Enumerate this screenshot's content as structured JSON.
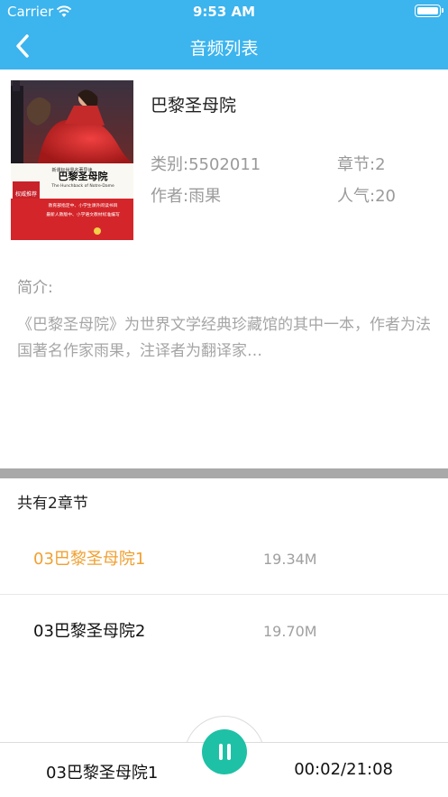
{
  "status_bar": {
    "carrier": "Carrier",
    "time": "9:53 AM"
  },
  "nav": {
    "title": "音频列表"
  },
  "book": {
    "title": "巴黎圣母院",
    "category": "类别:5502011",
    "chapters": "章节:2",
    "author": "作者:雨果",
    "popularity": "人气:20",
    "intro_label": "简介:",
    "intro_text": "《巴黎圣母院》为世界文学经典珍藏馆的其中一本，作者为法国著名作家雨果，注译者为翻译家…",
    "cover_lines": {
      "series": "新课标世界名著导读",
      "badge": "权威推荐",
      "cn_title": "巴黎圣母院",
      "en_title": "The Hunchback of Notre-Dame",
      "band1": "教育部指定中、小学生课外阅读书目",
      "band2": "最新人教版中、小学语文教材标准编写"
    }
  },
  "list": {
    "count_label": "共有2章节",
    "items": [
      {
        "name": "03巴黎圣母院1",
        "size": "19.34M",
        "active": true
      },
      {
        "name": "03巴黎圣母院2",
        "size": "19.70M",
        "active": false
      }
    ]
  },
  "player": {
    "now_playing": "03巴黎圣母院1",
    "time": "00:02/21:08"
  },
  "colors": {
    "header": "#3cb4ee",
    "active": "#f0a032",
    "play": "#1ec1a5",
    "separator": "#a9a9a9"
  }
}
